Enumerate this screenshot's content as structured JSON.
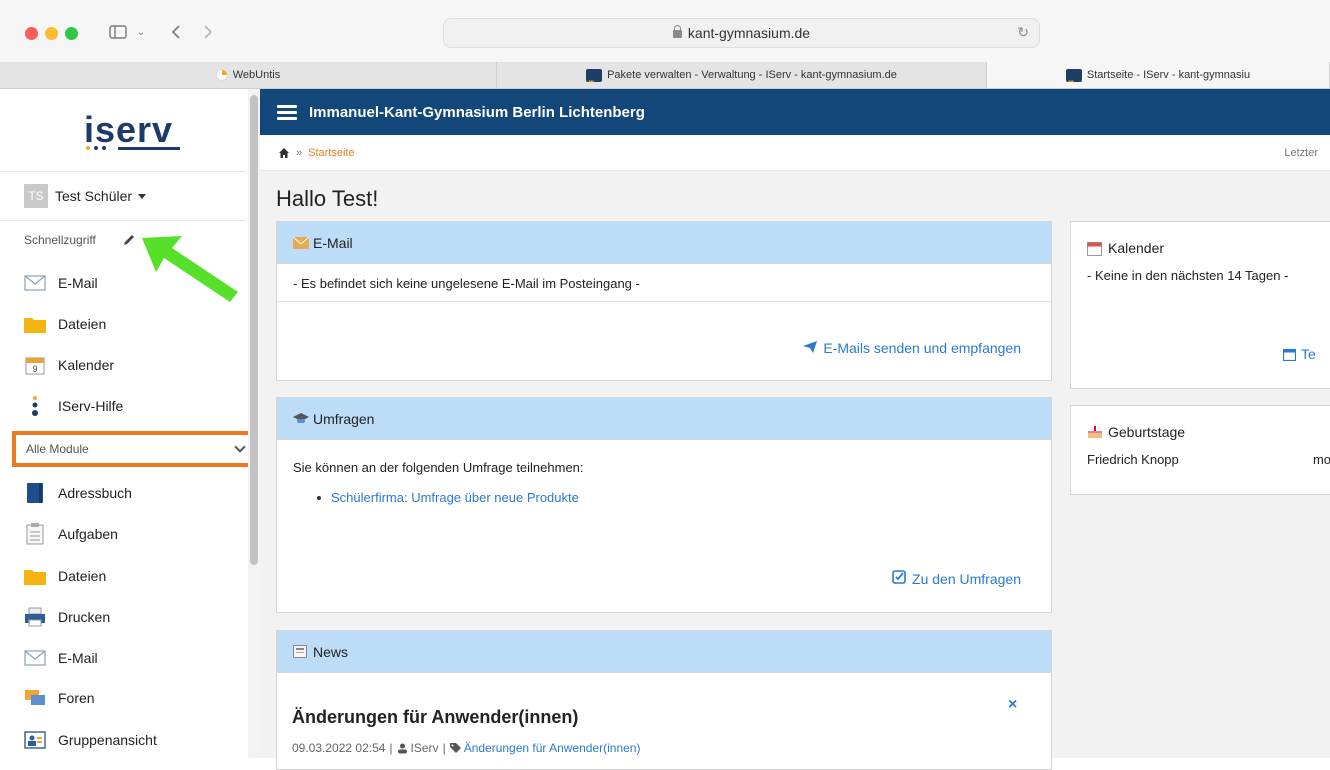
{
  "browser": {
    "url": "kant-gymnasium.de",
    "tabs": [
      {
        "label": "WebUntis"
      },
      {
        "label": "Pakete verwalten - Verwaltung - IServ - kant-gymnasium.de"
      },
      {
        "label": "Startseite - IServ - kant-gymnasiu"
      }
    ]
  },
  "sidebar": {
    "logo": "iserv",
    "user": {
      "initials": "TS",
      "name": "Test Schüler"
    },
    "quick_access_label": "Schnellzugriff",
    "quick_items": [
      {
        "label": "E-Mail",
        "icon": "mail-icon"
      },
      {
        "label": "Dateien",
        "icon": "folder-icon"
      },
      {
        "label": "Kalender",
        "icon": "calendar-icon"
      },
      {
        "label": "IServ-Hilfe",
        "icon": "help-icon"
      }
    ],
    "modules_select": "Alle Module",
    "modules": [
      {
        "label": "Adressbuch",
        "icon": "addressbook-icon"
      },
      {
        "label": "Aufgaben",
        "icon": "tasks-icon"
      },
      {
        "label": "Dateien",
        "icon": "folder-icon"
      },
      {
        "label": "Drucken",
        "icon": "printer-icon"
      },
      {
        "label": "E-Mail",
        "icon": "mail-icon"
      },
      {
        "label": "Foren",
        "icon": "forum-icon"
      },
      {
        "label": "Gruppenansicht",
        "icon": "group-icon"
      }
    ]
  },
  "header": {
    "school_name": "Immanuel-Kant-Gymnasium Berlin Lichtenberg"
  },
  "breadcrumb": {
    "separator": "»",
    "current": "Startseite",
    "right_text": "Letzter"
  },
  "main": {
    "greeting": "Hallo Test!",
    "email_panel": {
      "title": "E-Mail",
      "message": "- Es befindet sich keine ungelesene E-Mail im Posteingang -",
      "link": "E-Mails senden und empfangen"
    },
    "survey_panel": {
      "title": "Umfragen",
      "intro": "Sie können an der folgenden Umfrage teilnehmen:",
      "items": [
        "Schülerfirma: Umfrage über neue Produkte"
      ],
      "link": "Zu den Umfragen"
    },
    "news_panel": {
      "title": "News",
      "article_title": "Änderungen für Anwender(innen)",
      "date": "09.03.2022 02:54",
      "author": "IServ",
      "tag": "Änderungen für Anwender(innen)",
      "close": "×"
    }
  },
  "right": {
    "calendar": {
      "title": "Kalender",
      "message": "- Keine in den nächsten 14 Tagen -",
      "link": "Te"
    },
    "birthdays": {
      "title": "Geburtstage",
      "name": "Friedrich Knopp",
      "value": "mo"
    }
  },
  "colors": {
    "topbar": "#13477a",
    "panel_header": "#bcdcf7",
    "link": "#2a7ad0",
    "breadcrumb": "#e67e22",
    "highlight_box": "#ee7722",
    "arrow": "#56e02a"
  }
}
